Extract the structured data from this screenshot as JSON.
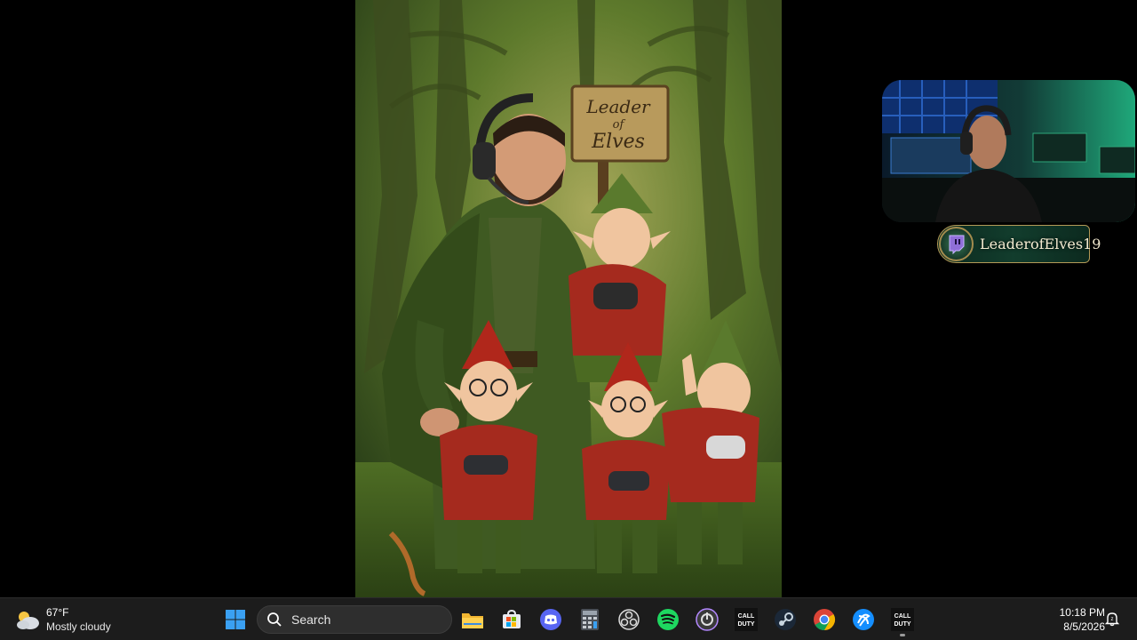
{
  "artwork": {
    "sign_line1": "Leader",
    "sign_line2": "of",
    "sign_line3": "Elves"
  },
  "stream_overlay": {
    "channel_name": "LeaderofElves19"
  },
  "taskbar": {
    "weather": {
      "temperature": "67°F",
      "condition": "Mostly cloudy",
      "icon": "partly-cloudy-icon"
    },
    "search": {
      "placeholder": "Search"
    },
    "apps": [
      {
        "name": "File Explorer",
        "icon": "folder-icon"
      },
      {
        "name": "Microsoft Store",
        "icon": "store-icon"
      },
      {
        "name": "Discord",
        "icon": "discord-icon"
      },
      {
        "name": "Calculator",
        "icon": "calculator-icon"
      },
      {
        "name": "OBS Studio",
        "icon": "obs-icon"
      },
      {
        "name": "Spotify",
        "icon": "spotify-icon"
      },
      {
        "name": "Streamer.bot",
        "icon": "streamer-icon"
      },
      {
        "name": "Call of Duty",
        "icon": "cod-icon"
      },
      {
        "name": "Steam",
        "icon": "steam-icon"
      },
      {
        "name": "Google Chrome",
        "icon": "chrome-icon"
      },
      {
        "name": "Battle.net",
        "icon": "battlenet-icon"
      },
      {
        "name": "Call of Duty",
        "icon": "cod-icon"
      }
    ],
    "clock": {
      "time": "10:18 PM",
      "date": "8/5/2026"
    }
  },
  "colors": {
    "taskbar_bg": "#1c1c1c",
    "forest_green": "#4f6d2a",
    "elf_red": "#a52a1e",
    "accent_gold": "#b49a57"
  }
}
